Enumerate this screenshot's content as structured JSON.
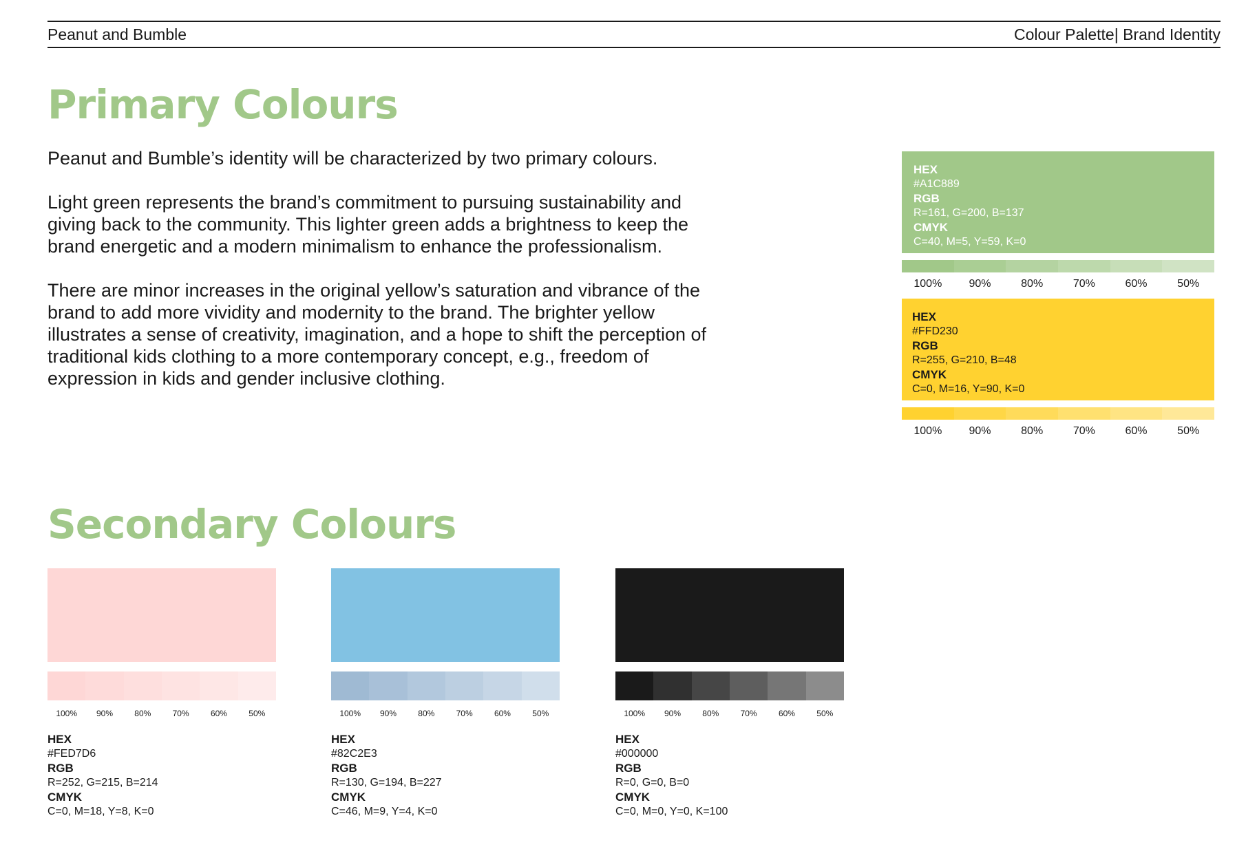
{
  "header": {
    "left": "Peanut and Bumble",
    "right": "Colour Palette| Brand Identity"
  },
  "primary": {
    "title": "Primary Colours",
    "paragraphs": [
      "Peanut and Bumble’s identity will be characterized by two primary colours.",
      "Light green represents the brand’s commitment to pursuing sustainability and giving back to the community. This lighter green adds a brightness to keep the brand energetic and a modern minimalism to enhance the professionalism.",
      "There are minor increases in the original yellow’s saturation and vibrance of the brand to add more vividity and modernity to the brand. The brighter yellow illustrates a sense of creativity, imagination, and a hope to shift the perception of traditional kids clothing to a more contemporary concept, e.g., freedom of expression in kids and gender inclusive clothing."
    ],
    "swatches": [
      {
        "color": "#A1C889",
        "hex_label": "HEX",
        "hex": "#A1C889",
        "rgb_label": "RGB",
        "rgb": "R=161, G=200, B=137",
        "cmyk_label": "CMYK",
        "cmyk": "C=40, M=5, Y=59, K=0",
        "tints": [
          "100%",
          "90%",
          "80%",
          "70%",
          "60%",
          "50%"
        ]
      },
      {
        "color": "#FFD230",
        "hex_label": "HEX",
        "hex": "#FFD230",
        "rgb_label": "RGB",
        "rgb": "R=255, G=210, B=48",
        "cmyk_label": "CMYK",
        "cmyk": "C=0, M=16, Y=90, K=0",
        "tints": [
          "100%",
          "90%",
          "80%",
          "70%",
          "60%",
          "50%"
        ]
      }
    ]
  },
  "secondary": {
    "title": "Secondary Colours",
    "swatches": [
      {
        "color": "#FED7D6",
        "hex_label": "HEX",
        "hex": "#FED7D6",
        "rgb_label": "RGB",
        "rgb": "R=252, G=215, B=214",
        "cmyk_label": "CMYK",
        "cmyk": "C=0, M=18, Y=8, K=0",
        "tints": [
          "100%",
          "90%",
          "80%",
          "70%",
          "60%",
          "50%"
        ]
      },
      {
        "color": "#82C2E3",
        "hex_label": "HEX",
        "hex": "#82C2E3",
        "rgb_label": "RGB",
        "rgb": "R=130, G=194, B=227",
        "cmyk_label": "CMYK",
        "cmyk": "C=46, M=9, Y=4, K=0",
        "tints": [
          "100%",
          "90%",
          "80%",
          "70%",
          "60%",
          "50%"
        ]
      },
      {
        "color": "#000000",
        "hex_label": "HEX",
        "hex": "#000000",
        "rgb_label": "RGB",
        "rgb": "R=0, G=0, B=0",
        "cmyk_label": "CMYK",
        "cmyk": "C=0, M=0, Y=0, K=100",
        "tints": [
          "100%",
          "90%",
          "80%",
          "70%",
          "60%",
          "50%"
        ]
      }
    ]
  },
  "tint_colors": {
    "green": [
      "#A1C889",
      "#AACE94",
      "#B4D3A1",
      "#BDD9AC",
      "#C7DEB8",
      "#D0E3C4"
    ],
    "yellow": [
      "#FFD230",
      "#FFD746",
      "#FFDB5A",
      "#FFE06F",
      "#FFE483",
      "#FFE898"
    ],
    "pink": [
      "#FED7D6",
      "#FEDBDA",
      "#FEDFDE",
      "#FEE3E2",
      "#FEE7E6",
      "#FEEBEB"
    ],
    "blue": [
      "#9FBAD3",
      "#A8C0D8",
      "#B2C8DD",
      "#BCCFE1",
      "#C6D6E6",
      "#D0DEEB"
    ],
    "black": [
      "#1A1A1A",
      "#303030",
      "#464646",
      "#5E5E5E",
      "#767676",
      "#8C8C8C"
    ]
  }
}
